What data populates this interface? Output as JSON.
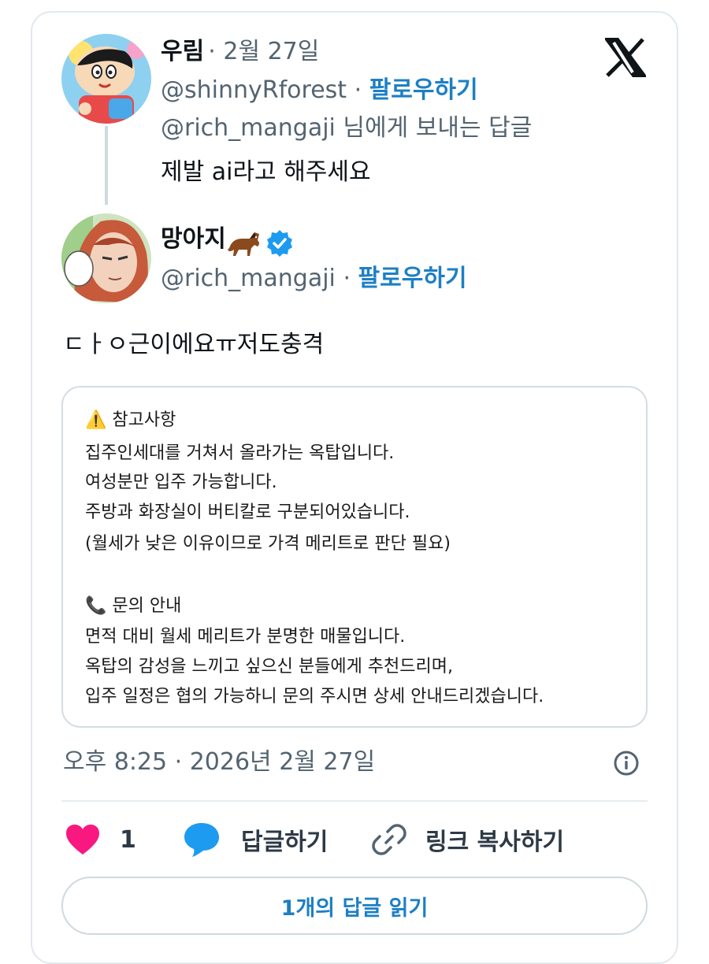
{
  "reply": {
    "display_name": "우림",
    "date": "· 2월 27일",
    "handle": "@shinnyRforest",
    "follow_label": "팔로우하기",
    "replying_to": "@rich_mangaji 님에게 보내는 답글",
    "text": "제발 ai라고 해주세요"
  },
  "main": {
    "display_name": "망아지",
    "handle": "@rich_mangaji",
    "follow_label": "팔로우하기",
    "text": "ㄷㅏㅇ근이에요ㅠ저도충격",
    "quote_lines": [
      "⚠️ 참고사항",
      "집주인세대를 거쳐서 올라가는 옥탑입니다.",
      "여성분만 입주 가능합니다.",
      "주방과 화장실이 버티칼로 구분되어있습니다.",
      "(월세가 낮은 이유이므로 가격 메리트로 판단 필요)",
      "📞 문의 안내",
      "면적 대비 월세 메리트가 분명한 매물입니다.",
      "옥탑의 감성을 느끼고 싶으신 분들에게 추천드리며,",
      "입주 일정은 협의 가능하니 문의 주시면 상세 안내드리겠습니다."
    ],
    "timestamp": "오후 8:25 · 2026년 2월 27일"
  },
  "actions": {
    "like_count": "1",
    "reply_label": "답글하기",
    "copy_link_label": "링크 복사하기"
  },
  "read_replies_label": "1개의 답글 읽기",
  "colors": {
    "accent": "#1d7fc4",
    "like": "#f91880",
    "reply_bubble": "#1d9bf0",
    "verified": "#1d9bf0"
  }
}
